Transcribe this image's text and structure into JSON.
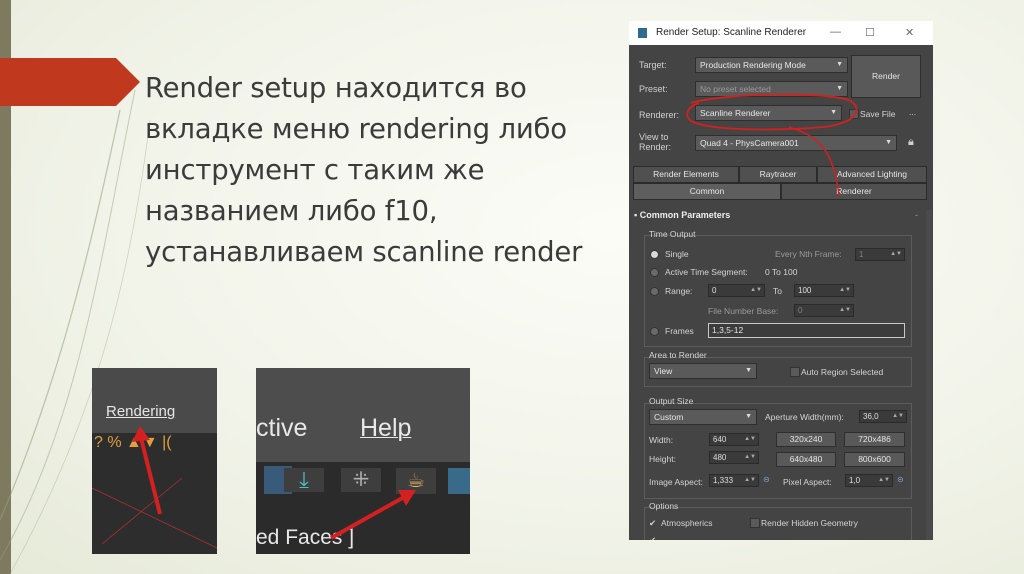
{
  "slide": {
    "text": "Render setup находится во вкладке меню rendering либо инструмент с таким же названием либо f10, устанавливаем scanline render"
  },
  "render_setup": {
    "title": "Render Setup: Scanline Renderer",
    "target_label": "Target:",
    "target_value": "Production Rendering Mode",
    "preset_label": "Preset:",
    "preset_value": "No preset selected",
    "render_button": "Render",
    "renderer_label": "Renderer:",
    "renderer_value": "Scanline Renderer",
    "save_file_label": "Save File",
    "more_label": "...",
    "view_label": "View to\nRender:",
    "view_value": "Quad 4 - PhysCamera001",
    "tabs_row1": [
      "Render Elements",
      "Raytracer",
      "Advanced Lighting"
    ],
    "tabs_row2": [
      "Common",
      "Renderer"
    ],
    "panel_title": "Common Parameters",
    "panel_toggle": "-",
    "time_output": {
      "title": "Time Output",
      "single": "Single",
      "every_nth": "Every Nth Frame:",
      "every_nth_value": "1",
      "active_segment": "Active Time Segment:",
      "active_range": "0 To 100",
      "range": "Range:",
      "range_from": "0",
      "to": "To",
      "range_to": "100",
      "file_number_base": "File Number Base:",
      "file_number_value": "0",
      "frames": "Frames",
      "frames_value": "1,3,5-12"
    },
    "area_to_render": {
      "title": "Area to Render",
      "value": "View",
      "auto_region": "Auto Region Selected"
    },
    "output_size": {
      "title": "Output Size",
      "preset": "Custom",
      "aperture_label": "Aperture Width(mm):",
      "aperture_value": "36,0",
      "width_label": "Width:",
      "width_value": "640",
      "height_label": "Height:",
      "height_value": "480",
      "presets": [
        "320x240",
        "720x486",
        "640x480",
        "800x600"
      ],
      "image_aspect_label": "Image Aspect:",
      "image_aspect_value": "1,333",
      "pixel_aspect_label": "Pixel Aspect:",
      "pixel_aspect_value": "1,0"
    },
    "options": {
      "title": "Options",
      "atmospherics": "Atmospherics",
      "render_hidden": "Render Hidden Geometry"
    }
  },
  "menu_crop_1": {
    "label": "Rendering"
  },
  "menu_crop_2": {
    "label_active": "ctive",
    "label_help": "Help",
    "label_faces": "ed Faces ]"
  },
  "colors": {
    "accent_red": "#d42020",
    "banner_red": "#c0391f"
  }
}
